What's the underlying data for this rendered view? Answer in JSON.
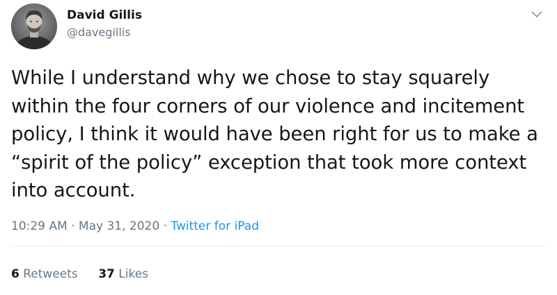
{
  "author": {
    "display_name": "David Gillis",
    "handle": "@davegillis"
  },
  "tweet": {
    "text": "While I understand why we chose to stay squarely within the four corners of our violence and incitement policy, I think it would have been right for us to make a “spirit of the policy” exception that took more context into account."
  },
  "meta": {
    "time": "10:29 AM",
    "separator": "·",
    "date": "May 31, 2020",
    "source": "Twitter for iPad"
  },
  "stats": {
    "retweets_count": "6",
    "retweets_label": "Retweets",
    "likes_count": "37",
    "likes_label": "Likes"
  },
  "icons": {
    "more_menu": "chevron-down-icon"
  },
  "colors": {
    "text_primary": "#14171a",
    "text_secondary": "#657786",
    "link": "#1b95e0",
    "divider": "#e6ecf0"
  }
}
